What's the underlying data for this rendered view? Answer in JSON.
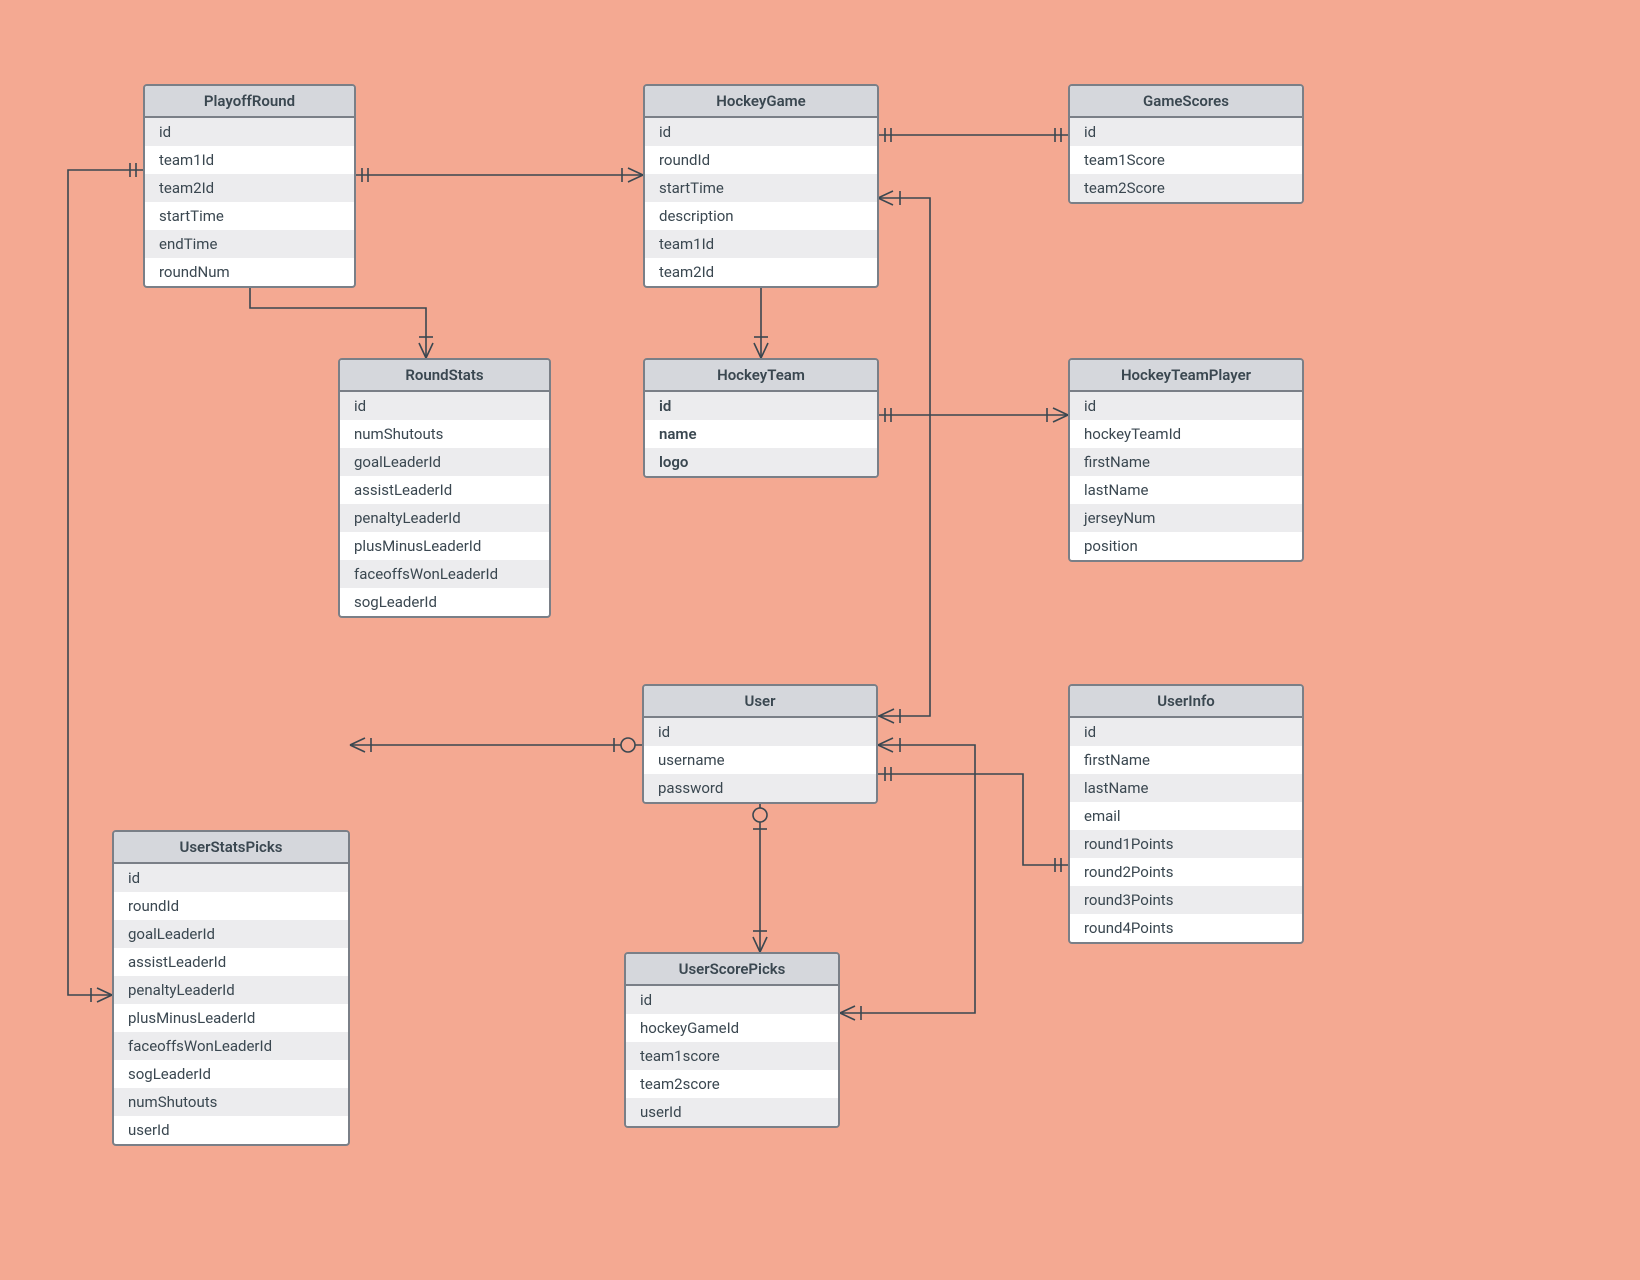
{
  "entities": {
    "playoffRound": {
      "title": "PlayoffRound",
      "fields": [
        "id",
        "team1Id",
        "team2Id",
        "startTime",
        "endTime",
        "roundNum"
      ]
    },
    "hockeyGame": {
      "title": "HockeyGame",
      "fields": [
        "id",
        "roundId",
        "startTime",
        "description",
        "team1Id",
        "team2Id"
      ]
    },
    "gameScores": {
      "title": "GameScores",
      "fields": [
        "id",
        "team1Score",
        "team2Score"
      ]
    },
    "roundStats": {
      "title": "RoundStats",
      "fields": [
        "id",
        "numShutouts",
        "goalLeaderId",
        "assistLeaderId",
        "penaltyLeaderId",
        "plusMinusLeaderId",
        "faceoffsWonLeaderId",
        "sogLeaderId"
      ]
    },
    "hockeyTeam": {
      "title": "HockeyTeam",
      "fields": [
        "id",
        "name",
        "logo"
      ],
      "bold": true
    },
    "hockeyTeamPlayer": {
      "title": "HockeyTeamPlayer",
      "fields": [
        "id",
        "hockeyTeamId",
        "firstName",
        "lastName",
        "jerseyNum",
        "position"
      ]
    },
    "user": {
      "title": "User",
      "fields": [
        "id",
        "username",
        "password"
      ]
    },
    "userInfo": {
      "title": "UserInfo",
      "fields": [
        "id",
        "firstName",
        "lastName",
        "email",
        "round1Points",
        "round2Points",
        "round3Points",
        "round4Points"
      ]
    },
    "userStatsPicks": {
      "title": "UserStatsPicks",
      "fields": [
        "id",
        "roundId",
        "goalLeaderId",
        "assistLeaderId",
        "penaltyLeaderId",
        "plusMinusLeaderId",
        "faceoffsWonLeaderId",
        "sogLeaderId",
        "numShutouts",
        "userId"
      ]
    },
    "userScorePicks": {
      "title": "UserScorePicks",
      "fields": [
        "id",
        "hockeyGameId",
        "team1score",
        "team2score",
        "userId"
      ]
    }
  }
}
